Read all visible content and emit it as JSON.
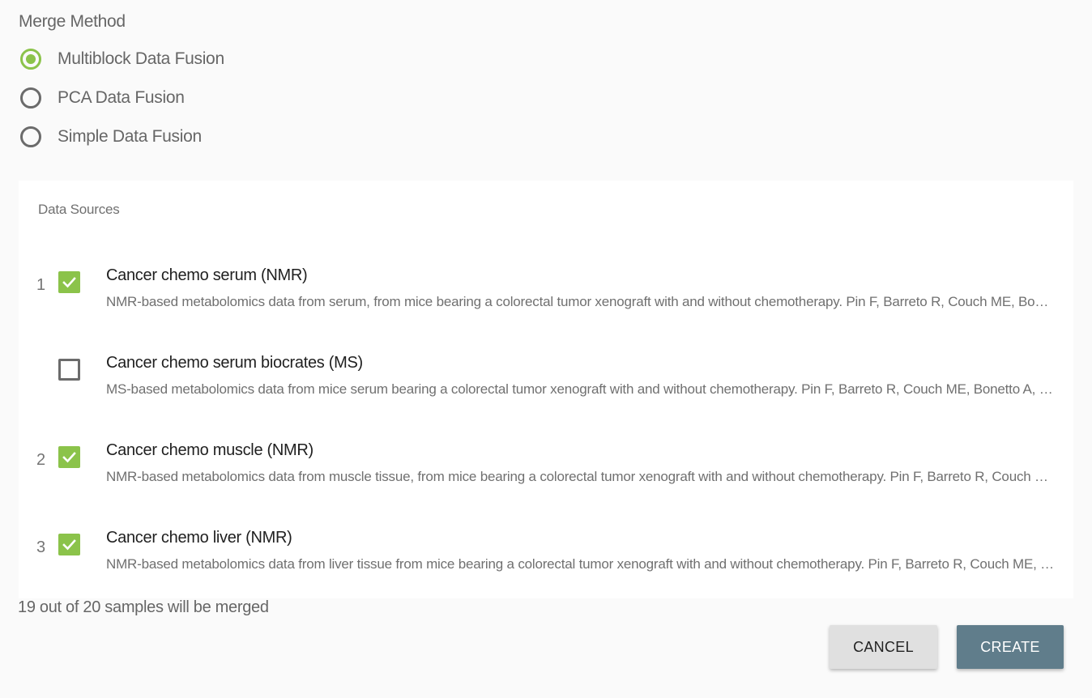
{
  "merge_method": {
    "label": "Merge Method",
    "options": [
      {
        "label": "Multiblock Data Fusion",
        "selected": true
      },
      {
        "label": "PCA Data Fusion",
        "selected": false
      },
      {
        "label": "Simple Data Fusion",
        "selected": false
      }
    ]
  },
  "data_sources": {
    "title": "Data Sources",
    "items": [
      {
        "index": "1",
        "checked": true,
        "name": "Cancer chemo serum (NMR)",
        "description": "NMR-based metabolomics data from serum, from mice bearing a colorectal tumor xenograft with and without chemotherapy. Pin F, Barreto R, Couch ME, Bonetto A..."
      },
      {
        "index": "",
        "checked": false,
        "name": "Cancer chemo serum biocrates (MS)",
        "description": "MS-based metabolomics data from mice serum bearing a colorectal tumor xenograft with and without chemotherapy. Pin F, Barreto R, Couch ME, Bonetto A, O'Con..."
      },
      {
        "index": "2",
        "checked": true,
        "name": "Cancer chemo muscle (NMR)",
        "description": "NMR-based metabolomics data from muscle tissue, from mice bearing a colorectal tumor xenograft with and without chemotherapy. Pin F, Barreto R, Couch ME, B..."
      },
      {
        "index": "3",
        "checked": true,
        "name": "Cancer chemo liver (NMR)",
        "description": "NMR-based metabolomics data from liver tissue from mice bearing a colorectal tumor xenograft with and without chemotherapy. Pin F, Barreto R, Couch ME, Bone..."
      }
    ]
  },
  "summary": "19 out of 20 samples will be merged",
  "actions": {
    "cancel_label": "CANCEL",
    "create_label": "CREATE"
  },
  "colors": {
    "accent_green": "#8bc34a",
    "create_button": "#607d8b",
    "cancel_button": "#e0e0e0"
  }
}
